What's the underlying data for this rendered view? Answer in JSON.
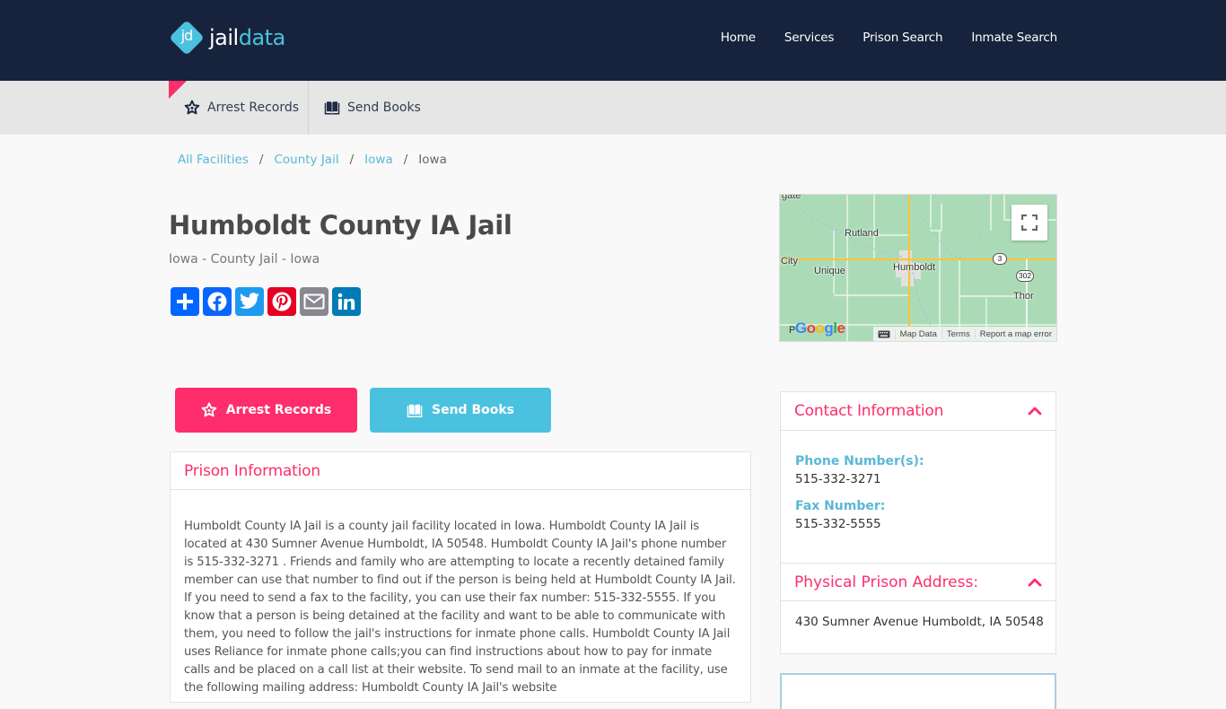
{
  "header": {
    "logo": {
      "mark": "jd",
      "text_primary": "jail",
      "text_accent": "data"
    },
    "nav": [
      "Home",
      "Services",
      "Prison Search",
      "Inmate Search"
    ]
  },
  "subbar": {
    "items": [
      {
        "label": "Arrest Records",
        "icon": "sheriff-star-icon"
      },
      {
        "label": "Send Books",
        "icon": "open-book-icon"
      }
    ]
  },
  "breadcrumb": {
    "links": [
      "All Facilities",
      "County Jail",
      "Iowa"
    ],
    "separator": "/",
    "current": "Iowa"
  },
  "page": {
    "title": "Humboldt County IA Jail",
    "subtitle": "Iowa - County Jail - Iowa"
  },
  "share": [
    {
      "name": "share",
      "icon": "plus-icon",
      "color": "#0166ff"
    },
    {
      "name": "facebook",
      "icon": "facebook-icon",
      "color": "#0866ff"
    },
    {
      "name": "twitter",
      "icon": "twitter-icon",
      "color": "#1d9bf0"
    },
    {
      "name": "pinterest",
      "icon": "pinterest-icon",
      "color": "#e60023"
    },
    {
      "name": "email",
      "icon": "email-icon",
      "color": "#888990"
    },
    {
      "name": "linkedin",
      "icon": "linkedin-icon",
      "color": "#007bb5"
    }
  ],
  "map": {
    "places": [
      "Rutland",
      "Humboldt",
      "Unique",
      "City",
      "Thor",
      "gate",
      "P"
    ],
    "shields": [
      "3",
      "302"
    ],
    "footer": [
      "Map Data",
      "Terms",
      "Report a map error"
    ],
    "brand": "Google"
  },
  "actions": {
    "arrest_records": "Arrest Records",
    "send_books": "Send Books"
  },
  "prison_info": {
    "heading": "Prison Information",
    "body": "Humboldt County IA Jail is a county jail facility located in Iowa. Humboldt County IA Jail is located at 430 Sumner Avenue Humboldt, IA 50548. Humboldt County IA Jail's phone number is 515-332-3271 . Friends and family who are attempting to locate a recently detained family member can use that number to find out if the person is being held at Humboldt County IA Jail. If you need to send a fax to the facility, you can use their fax number: 515-332-5555. If you know that a person is being detained at the facility and want to be able to communicate with them, you need to follow the jail's instructions for inmate phone calls. Humboldt County IA Jail uses Reliance for inmate phone calls;you can find instructions about how to pay for inmate calls and be placed on a call list at their website. To send mail to an inmate at the facility, use the following mailing address:   Humboldt County IA Jail's website"
  },
  "contact": {
    "heading": "Contact Information",
    "phone_label": "Phone Number(s):",
    "phone": "515-332-3271",
    "fax_label": "Fax Number:",
    "fax": "515-332-5555",
    "address_heading": "Physical Prison Address:",
    "address": "430 Sumner Avenue Humboldt, IA 50548"
  },
  "colors": {
    "header_bg": "#17233c",
    "accent_pink": "#ff2d6b",
    "accent_blue": "#4bc1e0",
    "subbar_bg": "#e6e6e6"
  }
}
